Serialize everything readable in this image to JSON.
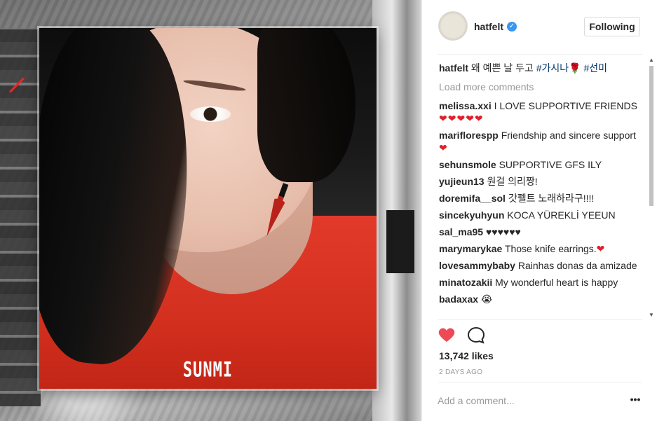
{
  "post": {
    "album_logo": "SUNMI"
  },
  "header": {
    "username": "hatfelt",
    "verified_mark": "✓",
    "follow_label": "Following"
  },
  "caption": {
    "username": "hatfelt",
    "text": "왜 예쁜 날 두고 ",
    "tag1": "#가시나🌹",
    "tag2": " #선미"
  },
  "load_more": "Load more comments",
  "comments": [
    {
      "user": "melissa.xxi",
      "text": "I LOVE SUPPORTIVE FRIENDS",
      "extra": "❤❤❤❤❤"
    },
    {
      "user": "mariflorespp",
      "text": "Friendship and sincere support",
      "extra": "❤"
    },
    {
      "user": "sehunsmole",
      "text": "SUPPORTIVE GFS ILY",
      "extra": ""
    },
    {
      "user": "yujieun13",
      "text": "원걸 의리짱!",
      "extra": ""
    },
    {
      "user": "doremifa__sol",
      "text": "갓펠트 노래하라구!!!!",
      "extra": ""
    },
    {
      "user": "sincekyuhyun",
      "text": "KOCA YÜREKLİ YEEUN",
      "extra": ""
    },
    {
      "user": "sal_ma95",
      "text": "♥♥♥♥♥♥",
      "extra": ""
    },
    {
      "user": "marymarykae",
      "text": "Those knife earrings.",
      "extra": "❤"
    },
    {
      "user": "lovesammybaby",
      "text": "Rainhas donas da amizade",
      "extra": ""
    },
    {
      "user": "minatozakii",
      "text": "My wonderful heart is happy",
      "extra": ""
    },
    {
      "user": "badaxax",
      "text": "😭",
      "extra": ""
    }
  ],
  "actions": {
    "like_icon": "heart-filled-icon",
    "comment_icon": "comment-bubble-icon"
  },
  "likes": "13,742 likes",
  "timestamp": "2 DAYS AGO",
  "add_comment": {
    "placeholder": "Add a comment..."
  },
  "more_options": "•••",
  "colors": {
    "like_red": "#ed4956",
    "verified_blue": "#3897f0",
    "hashtag": "#003569"
  }
}
